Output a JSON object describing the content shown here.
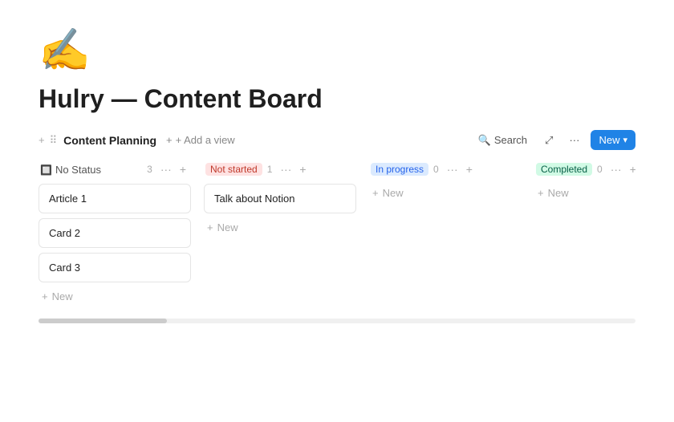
{
  "page": {
    "icon": "✍️",
    "title": "Hulry — Content Board"
  },
  "viewBar": {
    "view_label": "Content Planning",
    "add_view_label": "+ Add a view",
    "search_label": "Search",
    "more_label": "···",
    "expand_label": "⤢",
    "new_label": "New",
    "new_chevron": "▾"
  },
  "columns": [
    {
      "id": "no-status",
      "title": "No Status",
      "badge_type": "none",
      "count": "3",
      "cards": [
        "Article 1",
        "Card 2",
        "Card 3"
      ],
      "add_label": "New"
    },
    {
      "id": "not-started",
      "title": "Not started",
      "badge_type": "not-started",
      "count": "1",
      "cards": [
        "Talk about Notion"
      ],
      "add_label": "New"
    },
    {
      "id": "in-progress",
      "title": "In progress",
      "badge_type": "in-progress",
      "count": "0",
      "cards": [],
      "add_label": "New"
    },
    {
      "id": "completed",
      "title": "Completed",
      "badge_type": "completed",
      "count": "0",
      "cards": [],
      "add_label": "New"
    }
  ]
}
